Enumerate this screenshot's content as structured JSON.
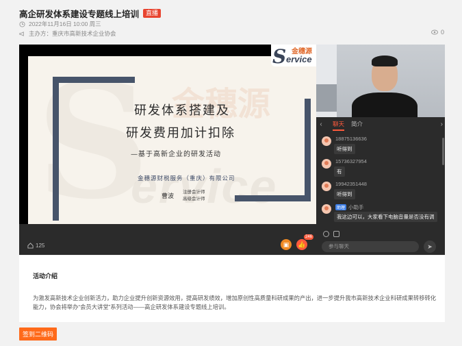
{
  "header": {
    "title": "高企研发体系建设专题线上培训",
    "live_badge": "直播",
    "date": "2022年11月16日 10:00 周三",
    "host": "主办方：重庆市高新技术企业协会",
    "views": "0"
  },
  "slide": {
    "line1": "研发体系搭建及",
    "line2": "研发费用加计扣除",
    "subtitle": "—基于高新企业的研发活动",
    "company": "金穗源财税服务（重庆）有限公司",
    "presenter": "曹波",
    "presenter_title1": "注册会计师",
    "presenter_title2": "高级会计师",
    "logo_letter": "S",
    "logo_word": "ervice",
    "logo_cn": "金穗源"
  },
  "chat": {
    "tabs": [
      "聊天",
      "简介"
    ],
    "messages": [
      {
        "name": "18875136636",
        "text": "听得到",
        "role": ""
      },
      {
        "name": "15736327954",
        "text": "有",
        "role": ""
      },
      {
        "name": "19942351448",
        "text": "听得到",
        "role": ""
      },
      {
        "name": "小助手",
        "text": "我这边可以，大家看下电脑音量是否没有调",
        "role": "助理"
      }
    ],
    "input_placeholder": "参与聊天"
  },
  "playbar": {
    "likes": "125",
    "thumb_count": "246"
  },
  "activity": {
    "title": "活动介绍",
    "body": "为激发高新技术企业创新活力，助力企业提升创新资源效用，提高研发绩效，增加原创性高质量科研成果的产出，进一步提升我市高新技术企业科研成果转移转化能力，协会将举办“会员大讲堂”系列活动——高企研发体系建设专题线上培训。"
  },
  "signin_label": "签到二维码",
  "colors": {
    "accent": "#ff5a3c",
    "badge": "#e8442f",
    "signin": "#ff6a1a"
  }
}
